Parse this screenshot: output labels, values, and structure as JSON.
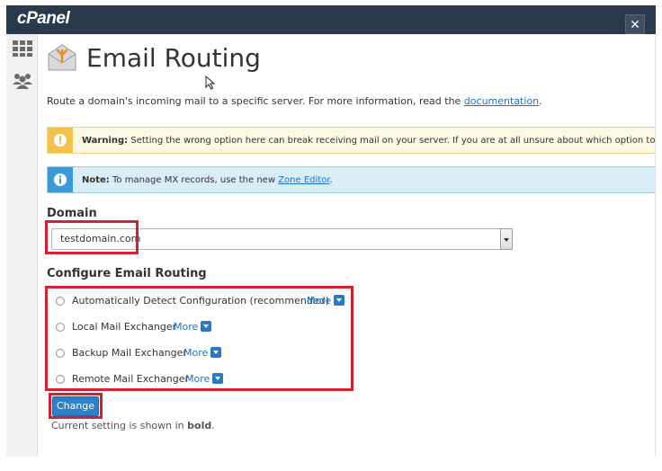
{
  "app": {
    "logo": "cPanel",
    "close_glyph": "✕"
  },
  "sidebar": {
    "items": [
      {
        "icon": "grid-icon"
      },
      {
        "icon": "users-icon"
      }
    ]
  },
  "page": {
    "title": "Email Routing",
    "description_prefix": "Route a domain's incoming mail to a specific server. For more information, read the ",
    "description_link": "documentation",
    "description_suffix": "."
  },
  "alerts": {
    "warning": {
      "label": "Warning:",
      "text": " Setting the wrong option here can break receiving mail on your server. If you are at all unsure about which option to selec"
    },
    "info": {
      "label": "Note:",
      "text_prefix": " To manage MX records, use the new ",
      "link": "Zone Editor",
      "text_suffix": "."
    }
  },
  "domain": {
    "label": "Domain",
    "selected": "testdomain.com"
  },
  "routing": {
    "label": "Configure Email Routing",
    "options": [
      {
        "label": "Automatically Detect Configuration (recommended)",
        "more": "More"
      },
      {
        "label": "Local Mail Exchanger",
        "more": "More"
      },
      {
        "label": "Backup Mail Exchanger",
        "more": "More"
      },
      {
        "label": "Remote Mail Exchanger",
        "more": "More"
      }
    ]
  },
  "actions": {
    "change_label": "Change"
  },
  "note": {
    "prefix": "Current setting is shown in ",
    "bold": "bold",
    "suffix": "."
  },
  "colors": {
    "topbar": "#293a4a",
    "accent": "#2f80c7",
    "highlight": "#d6202e",
    "warning_bg": "#fcf8e3",
    "info_bg": "#d9edf7"
  }
}
